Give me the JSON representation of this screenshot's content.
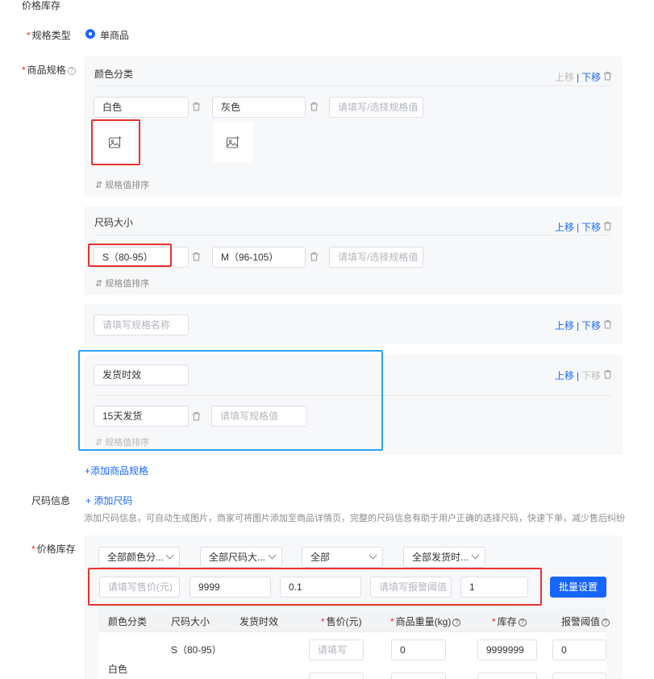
{
  "section_title": "价格库存",
  "spec_type": {
    "label": "规格类型",
    "option": "单商品"
  },
  "product_spec": {
    "label": "商品规格"
  },
  "groups": {
    "color": {
      "title": "颜色分类",
      "move_up": "上移",
      "move_down": "下移",
      "values": [
        "白色",
        "灰色"
      ],
      "placeholder": "请填写/选择规格值",
      "sort": "规格值排序"
    },
    "size": {
      "title": "尺码大小",
      "move_up": "上移",
      "move_down": "下移",
      "values": [
        "S（80-95）",
        "M（96-105）"
      ],
      "placeholder": "请填写/选择规格值",
      "sort": "规格值排序"
    },
    "new_spec": {
      "placeholder": "请填写规格名称",
      "move_up": "上移",
      "move_down": "下移"
    },
    "delivery": {
      "title_value": "发货时效",
      "move_up": "上移",
      "move_down": "下移",
      "values": [
        "15天发货"
      ],
      "placeholder": "请填写规格值",
      "sort": "规格值排序"
    }
  },
  "add_spec": "+添加商品规格",
  "size_info": {
    "label": "尺码信息",
    "add": "+ 添加尺码",
    "desc": "添加尺码信息，可自动生成图片，商家可将图片添加至商品详情页，完整的尺码信息有助于用户正确的选择尺码，快速下单，减少售后纠纷"
  },
  "price_stock": {
    "label": "价格库存",
    "filters": [
      "全部颜色分...",
      "全部尺码大...",
      "全部",
      "全部发货时..."
    ],
    "batch": {
      "price_placeholder": "请填写售价(元)",
      "weight": "9999",
      "stock": "0.1",
      "alert_placeholder": "请填写报警阈值",
      "last": "1",
      "button": "批量设置"
    },
    "table": {
      "headers": [
        "颜色分类",
        "尺码大小",
        "发货时效",
        "售价(元)",
        "商品重量(kg)",
        "库存",
        "报警阈值"
      ],
      "row1": {
        "color": "白色",
        "size": "S（80-95）",
        "price_placeholder": "请填写",
        "weight": "0",
        "stock": "9999999",
        "alert": "0"
      }
    }
  }
}
